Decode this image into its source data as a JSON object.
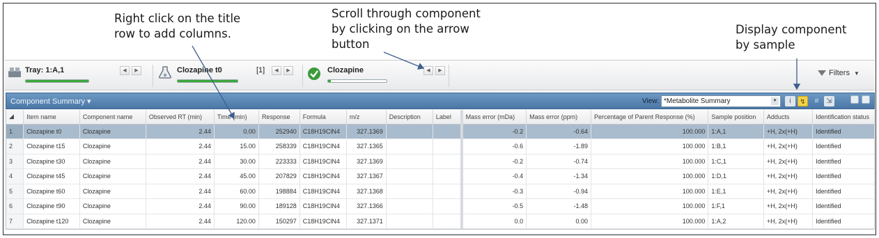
{
  "callouts": {
    "add_columns": "Right click on the title\nrow to add columns.",
    "scroll_component": "Scroll through component\nby clicking on the arrow\nbutton",
    "display_by_sample": "Display component\nby sample"
  },
  "toolbar": {
    "tray": {
      "label": "Tray: 1:A,1",
      "icon": "tray-icon",
      "progress": 1.0
    },
    "sample": {
      "label": "Clozapine t0",
      "index": "[1]",
      "icon": "flask-icon",
      "progress": 1.0
    },
    "component": {
      "label": "Clozapine",
      "icon": "check-icon",
      "progress": 0.05
    },
    "filters_label": "Filters"
  },
  "panel": {
    "title": "Component Summary ▾",
    "view_label": "View:",
    "view_value": "*Metabolite Summary"
  },
  "table": {
    "columns": [
      "Item name",
      "Component name",
      "Observed RT (min)",
      "Time (min)",
      "Response",
      "Formula",
      "m/z",
      "Description",
      "Label",
      "Mass error (mDa)",
      "Mass error (ppm)",
      "Percentage of Parent Response (%)",
      "Sample position",
      "Adducts",
      "Identification status"
    ],
    "rows": [
      [
        "1",
        "Clozapine t0",
        "Clozapine",
        "2.44",
        "0.00",
        "252940",
        "C18H19ClN4",
        "327.1369",
        "",
        "",
        "-0.2",
        "-0.64",
        "100.000",
        "1:A,1",
        "+H, 2x(+H)",
        "Identified"
      ],
      [
        "2",
        "Clozapine t15",
        "Clozapine",
        "2.44",
        "15.00",
        "258339",
        "C18H19ClN4",
        "327.1365",
        "",
        "",
        "-0.6",
        "-1.89",
        "100.000",
        "1:B,1",
        "+H, 2x(+H)",
        "Identified"
      ],
      [
        "3",
        "Clozapine t30",
        "Clozapine",
        "2.44",
        "30.00",
        "223333",
        "C18H19ClN4",
        "327.1369",
        "",
        "",
        "-0.2",
        "-0.74",
        "100.000",
        "1:C,1",
        "+H, 2x(+H)",
        "Identified"
      ],
      [
        "4",
        "Clozapine t45",
        "Clozapine",
        "2.44",
        "45.00",
        "207829",
        "C18H19ClN4",
        "327.1367",
        "",
        "",
        "-0.4",
        "-1.34",
        "100.000",
        "1:D,1",
        "+H, 2x(+H)",
        "Identified"
      ],
      [
        "5",
        "Clozapine t60",
        "Clozapine",
        "2.44",
        "60.00",
        "198884",
        "C18H19ClN4",
        "327.1368",
        "",
        "",
        "-0.3",
        "-0.94",
        "100.000",
        "1:E,1",
        "+H, 2x(+H)",
        "Identified"
      ],
      [
        "6",
        "Clozapine t90",
        "Clozapine",
        "2.44",
        "90.00",
        "189128",
        "C18H19ClN4",
        "327.1366",
        "",
        "",
        "-0.5",
        "-1.48",
        "100.000",
        "1:F,1",
        "+H, 2x(+H)",
        "Identified"
      ],
      [
        "7",
        "Clozapine t120",
        "Clozapine",
        "2.44",
        "120.00",
        "150297",
        "C18H19ClN4",
        "327.1371",
        "",
        "",
        "0.0",
        "0.00",
        "100.000",
        "1:A,2",
        "+H, 2x(+H)",
        "Identified"
      ]
    ],
    "selected_row": 0
  },
  "colors": {
    "accent_header": "#5b87b5",
    "selected_row": "#a9bccd",
    "progress_green": "#3aa83a"
  }
}
